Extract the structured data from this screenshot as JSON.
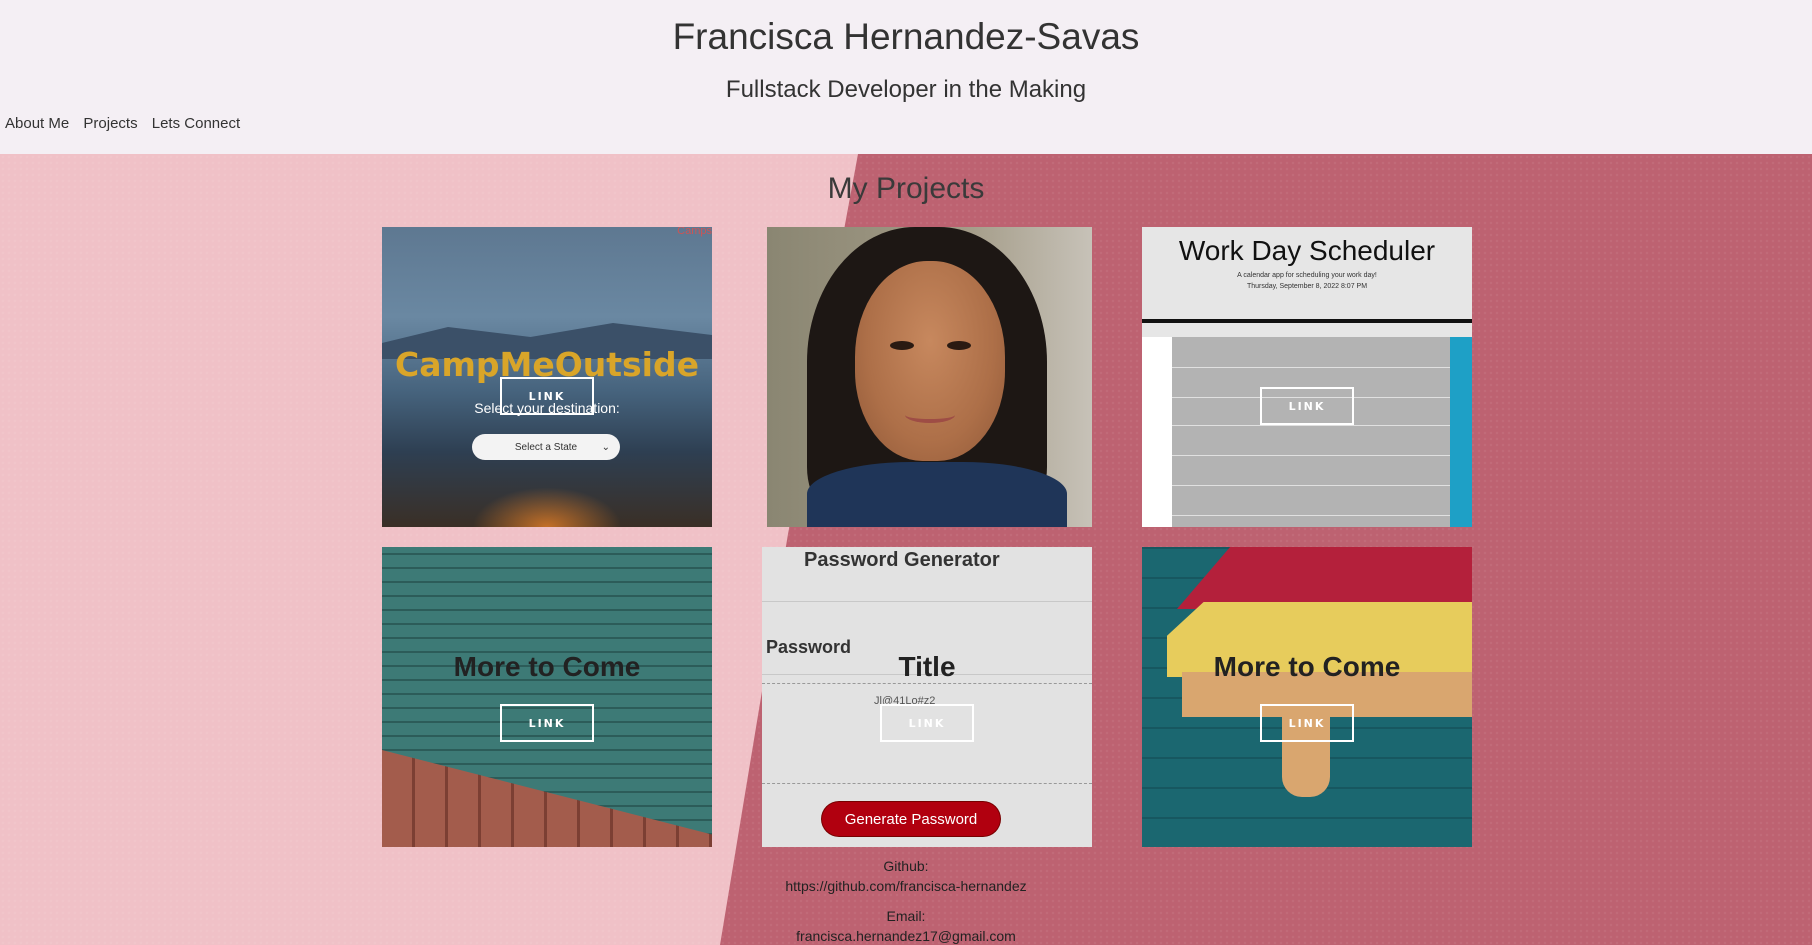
{
  "header": {
    "name": "Francisca Hernandez-Savas",
    "tagline": "Fullstack Developer in the Making"
  },
  "nav": {
    "items": [
      "About Me",
      "Projects",
      "Lets Connect"
    ]
  },
  "projects_section": {
    "title": "My Projects",
    "link_label": "LINK",
    "cards": [
      {
        "name": "CampMeOutside",
        "overlay_title": "",
        "corner_text": "Camps",
        "destination_text": "Select your destination:",
        "select_value": "Select a State"
      },
      {
        "name": "portrait",
        "overlay_title": ""
      },
      {
        "name": "Work Day Scheduler",
        "overlay_title": "",
        "subtitle": "A calendar app for scheduling your work day!",
        "date_text": "Thursday, September 8, 2022 8:07 PM"
      },
      {
        "name": "brick-wall",
        "overlay_title": "More to Come"
      },
      {
        "name": "Password Generator",
        "overlay_title": "Title",
        "password_label": "Password",
        "password_value": "Jl@41Lo#z2",
        "button_label": "Generate Password"
      },
      {
        "name": "arrow-wall",
        "overlay_title": "More to Come"
      }
    ]
  },
  "footer": {
    "github_label": "Github:",
    "github_url": "https://github.com/francisca-hernandez",
    "email_label": "Email:",
    "email": "francisca.hernandez17@gmail.com"
  },
  "colors": {
    "header_bg": "#f4eff4",
    "wall_light": "#f0c1c7",
    "wall_dark": "#bd6271",
    "generate_button": "#b1000f"
  }
}
